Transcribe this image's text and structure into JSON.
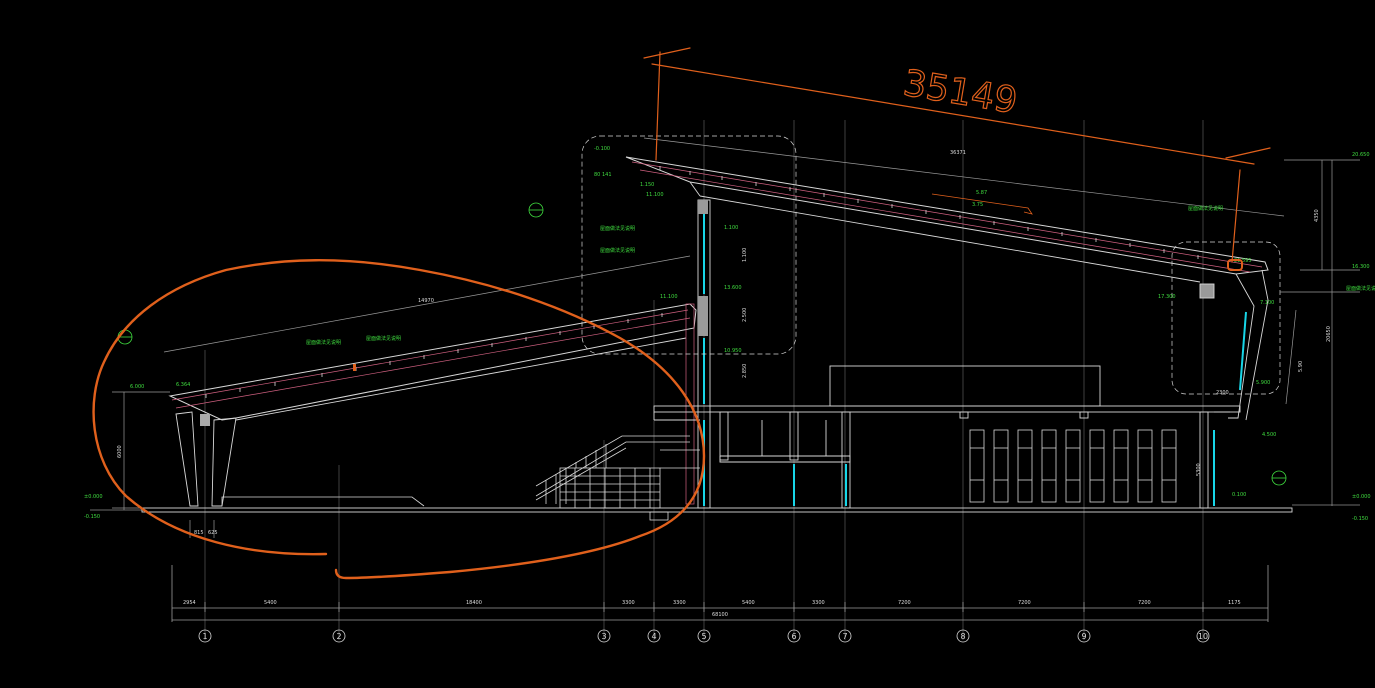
{
  "drawing": {
    "background": "#000000",
    "colors": {
      "structure": "#d8d8d8",
      "annotation": "#3fdc3f",
      "glazing": "#18d6e8",
      "markup": "#e0601c",
      "roof_lining": "#d06080",
      "dim_line": "#9a9a9a"
    },
    "markup_dimension": "35149",
    "grid_axes": [
      "1",
      "2",
      "3",
      "4",
      "5",
      "6",
      "7",
      "8",
      "9",
      "10"
    ],
    "left_level_labels": [
      "±0.000",
      "-0.150",
      "6.000"
    ],
    "right_level_labels": [
      "±0.000",
      "-0.150",
      "20.650",
      "16.300"
    ]
  }
}
